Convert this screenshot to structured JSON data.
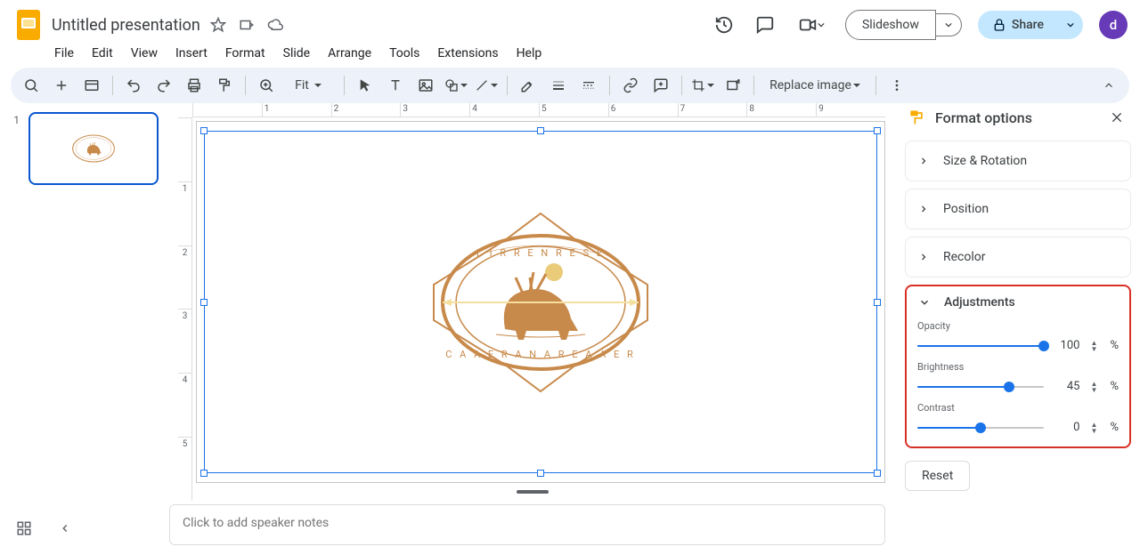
{
  "doc": {
    "title": "Untitled presentation",
    "avatar_initial": "d"
  },
  "header_buttons": {
    "slideshow": "Slideshow",
    "share": "Share"
  },
  "menu": [
    "File",
    "Edit",
    "View",
    "Insert",
    "Format",
    "Slide",
    "Arrange",
    "Tools",
    "Extensions",
    "Help"
  ],
  "toolbar": {
    "zoom_label": "Fit",
    "replace_image": "Replace image"
  },
  "ruler_h": [
    "1",
    "2",
    "3",
    "4",
    "5",
    "6",
    "7",
    "8",
    "9"
  ],
  "ruler_v": [
    "1",
    "2",
    "3",
    "4",
    "5"
  ],
  "filmstrip": {
    "slide_number": "1"
  },
  "notes_placeholder": "Click to add speaker notes",
  "format_panel": {
    "title": "Format options",
    "sections": {
      "size_rotation": "Size & Rotation",
      "position": "Position",
      "recolor": "Recolor",
      "adjustments": "Adjustments"
    },
    "adjust": {
      "opacity_label": "Opacity",
      "opacity_value": "100",
      "brightness_label": "Brightness",
      "brightness_value": "45",
      "contrast_label": "Contrast",
      "contrast_value": "0",
      "unit": "%"
    },
    "reset": "Reset"
  }
}
